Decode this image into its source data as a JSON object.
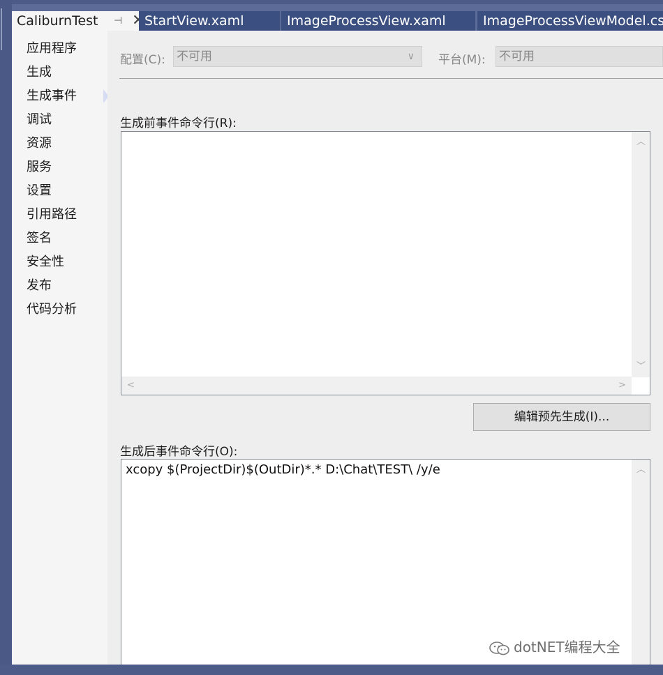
{
  "tabs": [
    {
      "label": "CaliburnTest",
      "active": true,
      "pin_icon": "pin-icon",
      "close_icon": "close-icon"
    },
    {
      "label": "StartView.xaml",
      "active": false
    },
    {
      "label": "ImageProcessView.xaml",
      "active": false
    },
    {
      "label": "ImageProcessViewModel.cs",
      "active": false
    }
  ],
  "sidebar": {
    "items": [
      {
        "label": "应用程序"
      },
      {
        "label": "生成"
      },
      {
        "label": "生成事件",
        "selected": true
      },
      {
        "label": "调试"
      },
      {
        "label": "资源"
      },
      {
        "label": "服务"
      },
      {
        "label": "设置"
      },
      {
        "label": "引用路径"
      },
      {
        "label": "签名"
      },
      {
        "label": "安全性"
      },
      {
        "label": "发布"
      },
      {
        "label": "代码分析"
      }
    ]
  },
  "config": {
    "config_label": "配置(C):",
    "config_value": "不可用",
    "platform_label": "平台(M):",
    "platform_value": "不可用"
  },
  "prebuild": {
    "label": "生成前事件命令行(R):",
    "value": ""
  },
  "edit_prebuild_button": "编辑预先生成(I)...",
  "postbuild": {
    "label": "生成后事件命令行(O):",
    "value": "xcopy $(ProjectDir)$(OutDir)*.* D:\\Chat\\TEST\\ /y/e"
  },
  "watermark": {
    "text": "dotNET编程大全",
    "icon": "wechat-icon"
  },
  "colors": {
    "frame": "#5d6b99",
    "tab_inactive": "#3b4f81",
    "selection": "#d6dcf2"
  }
}
